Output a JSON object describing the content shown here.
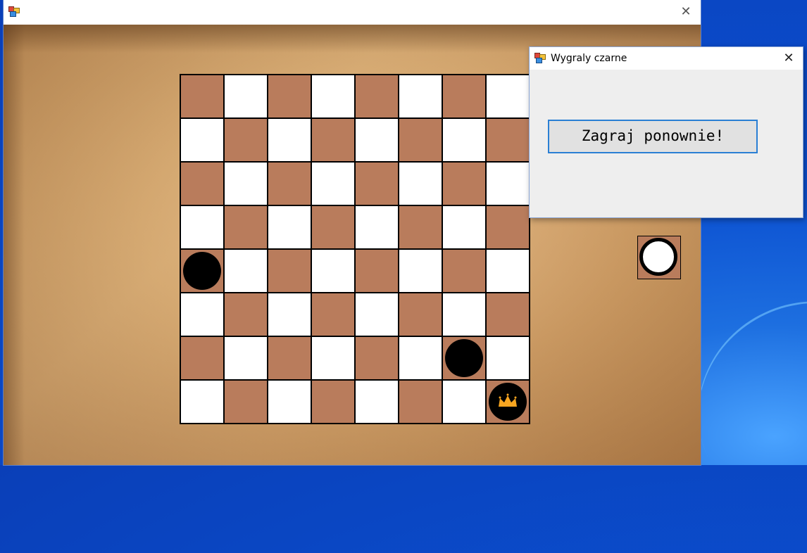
{
  "main_window": {
    "title": "",
    "icon": "app-icon",
    "close_icon": "close-icon"
  },
  "board": {
    "rows": 8,
    "cols": 8,
    "colors": {
      "dark": "#b97c5c",
      "light": "#ffffff"
    },
    "pieces": [
      {
        "row": 4,
        "col": 0,
        "color": "black",
        "king": false
      },
      {
        "row": 6,
        "col": 6,
        "color": "black",
        "king": false
      },
      {
        "row": 7,
        "col": 7,
        "color": "black",
        "king": true
      }
    ]
  },
  "turn_indicator": {
    "piece": "white"
  },
  "dialog": {
    "title": "Wygraly czarne",
    "button_label": "Zagraj ponownie!"
  },
  "colors": {
    "dialog_button_border": "#2a7fd4",
    "crown": "#f7a520"
  }
}
